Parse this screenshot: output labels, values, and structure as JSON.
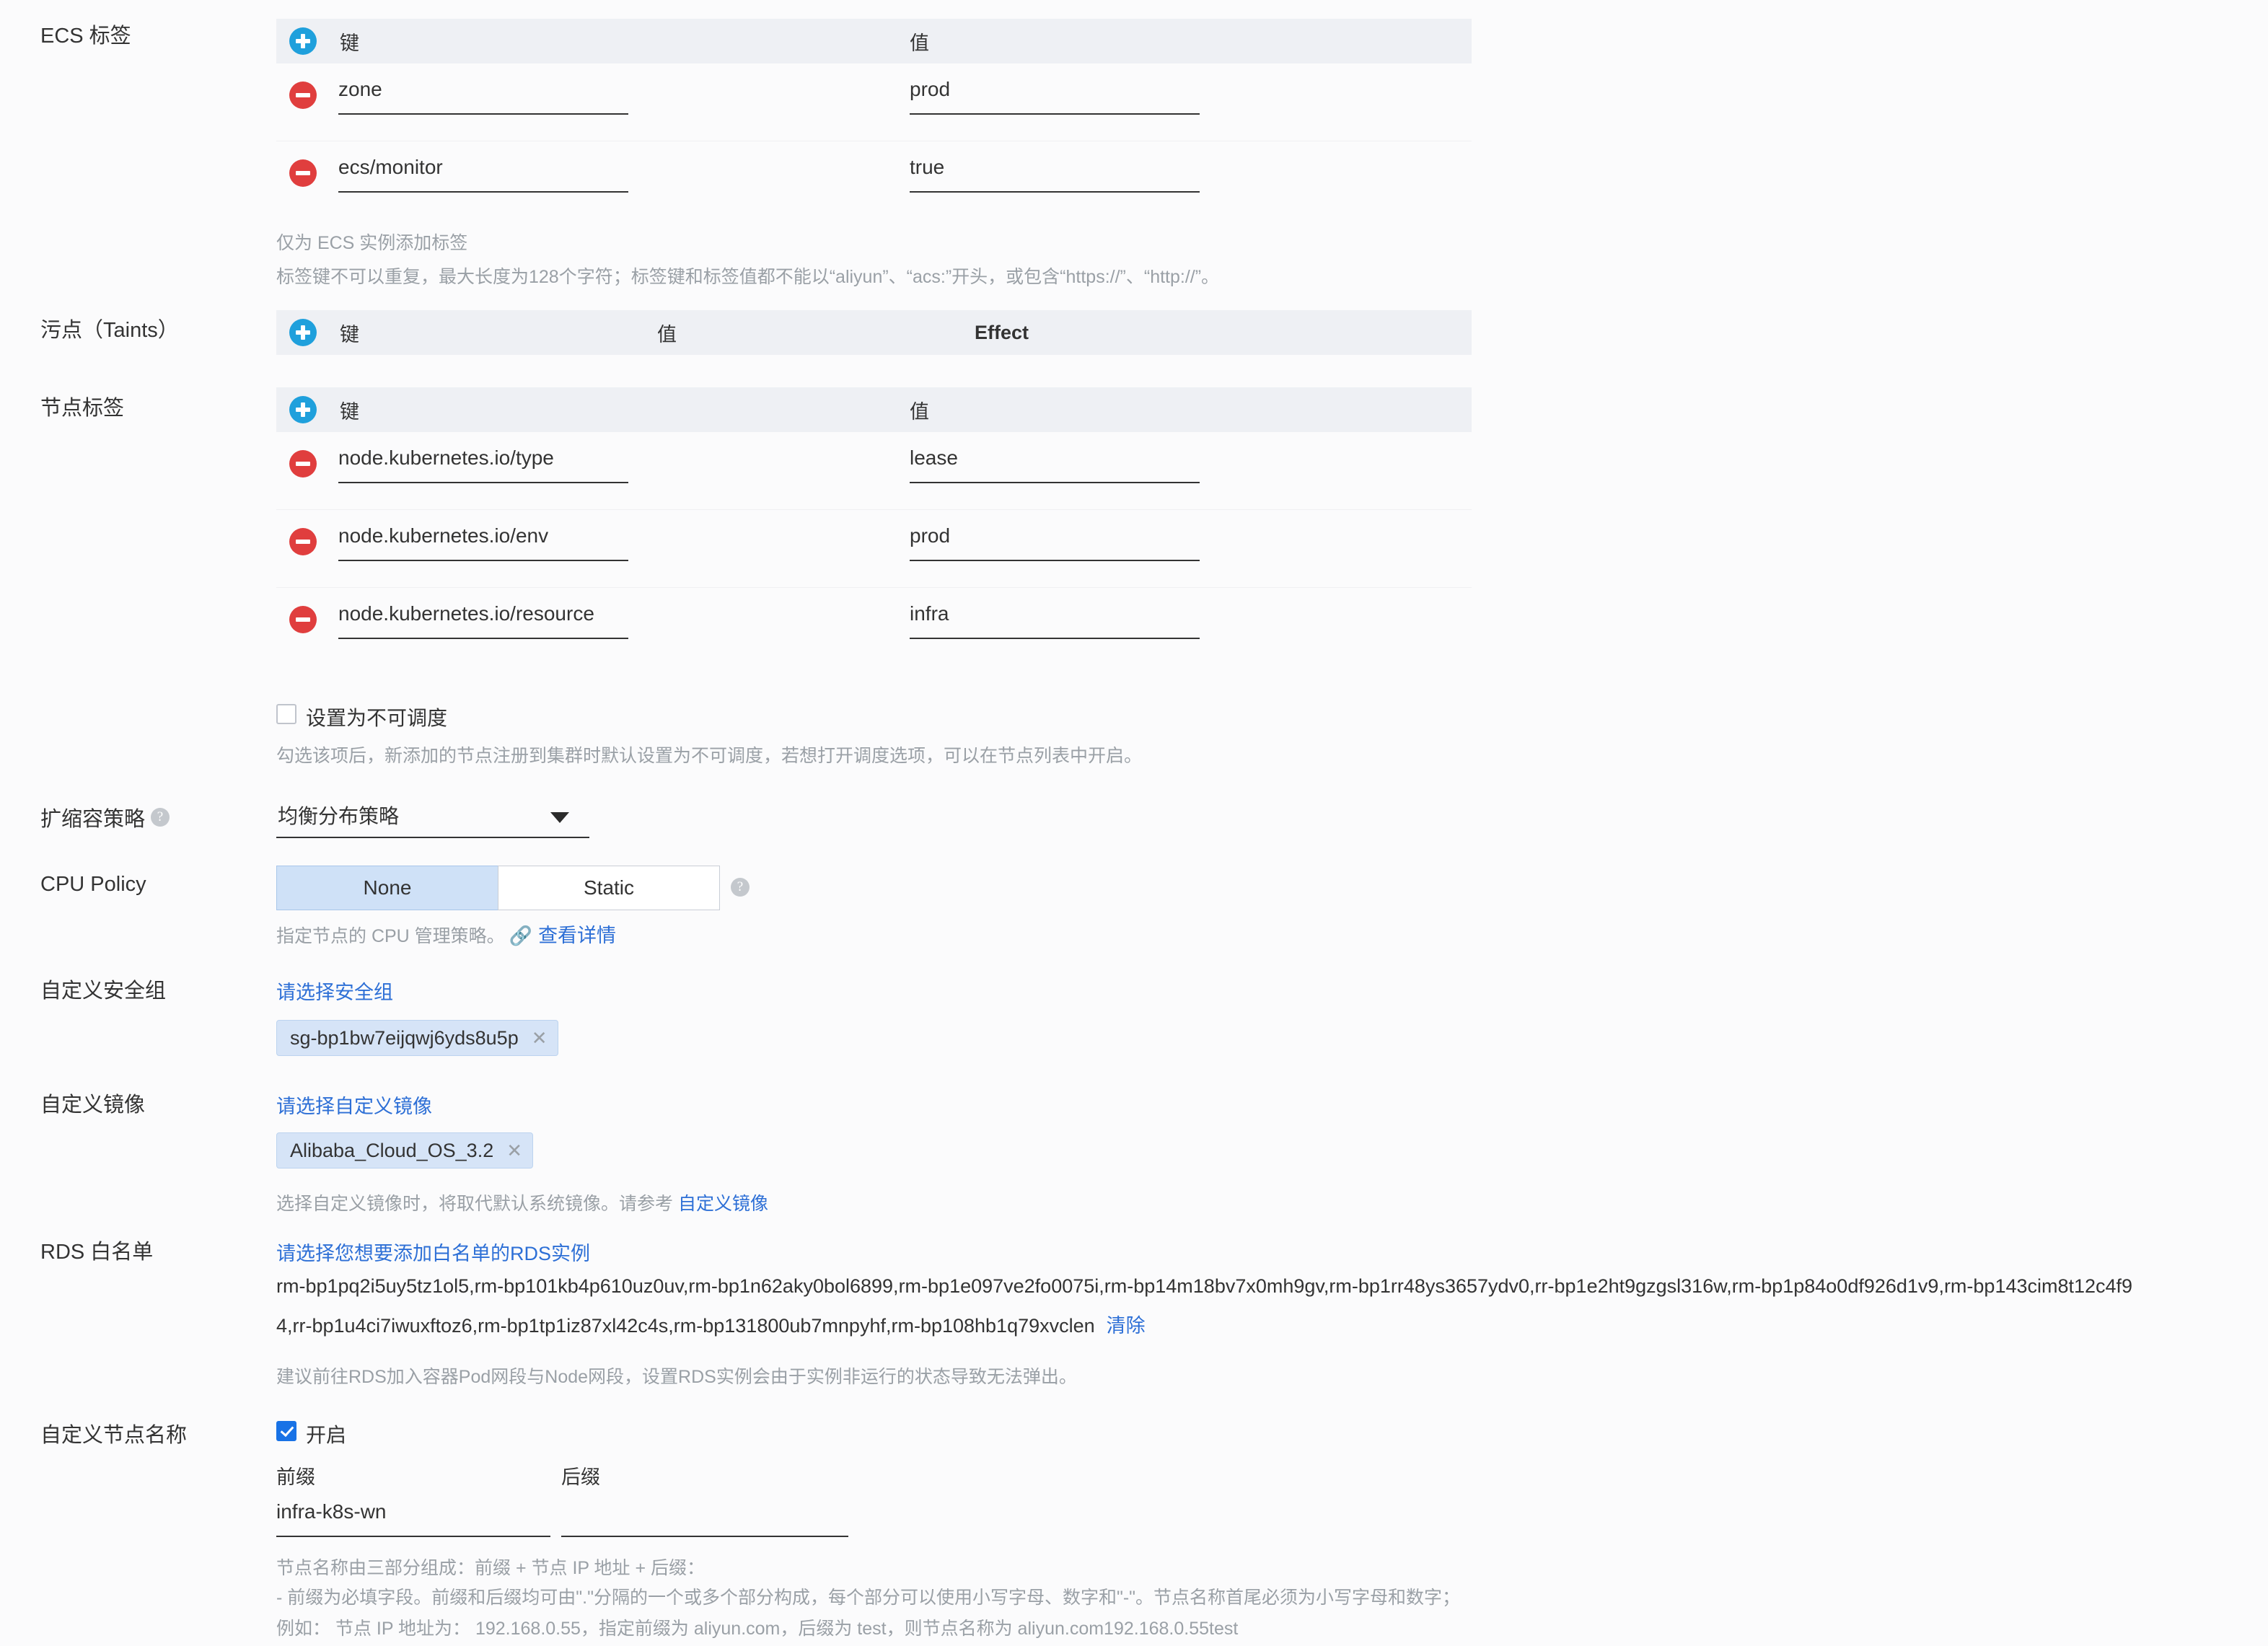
{
  "ecs_tags": {
    "label": "ECS 标签",
    "columns": {
      "key": "键",
      "value": "值"
    },
    "rows": [
      {
        "key": "zone",
        "value": "prod"
      },
      {
        "key": "ecs/monitor",
        "value": "true"
      }
    ],
    "hints": [
      "仅为 ECS 实例添加标签",
      "标签键不可以重复，最大长度为128个字符；标签键和标签值都不能以“aliyun”、“acs:”开头，或包含“https://”、“http://”。"
    ]
  },
  "taints": {
    "label": "污点（Taints）",
    "columns": {
      "key": "键",
      "value": "值",
      "effect": "Effect"
    },
    "rows": []
  },
  "node_labels": {
    "label": "节点标签",
    "columns": {
      "key": "键",
      "value": "值"
    },
    "rows": [
      {
        "key": "node.kubernetes.io/type",
        "value": "lease"
      },
      {
        "key": "node.kubernetes.io/env",
        "value": "prod"
      },
      {
        "key": "node.kubernetes.io/resource",
        "value": "infra"
      }
    ]
  },
  "unschedulable": {
    "checkbox_label": "设置为不可调度",
    "checked": false,
    "hint": "勾选该项后，新添加的节点注册到集群时默认设置为不可调度，若想打开调度选项，可以在节点列表中开启。"
  },
  "scaling_policy": {
    "label": "扩缩容策略",
    "selected": "均衡分布策略"
  },
  "cpu_policy": {
    "label": "CPU Policy",
    "options": [
      "None",
      "Static"
    ],
    "selected": "None",
    "hint_prefix": "指定节点的 CPU 管理策略。",
    "hint_link": "查看详情"
  },
  "security_group": {
    "label": "自定义安全组",
    "link": "请选择安全组",
    "chips": [
      "sg-bp1bw7eijqwj6yds8u5p"
    ]
  },
  "custom_image": {
    "label": "自定义镜像",
    "link": "请选择自定义镜像",
    "chips": [
      "Alibaba_Cloud_OS_3.2"
    ],
    "hint_prefix": "选择自定义镜像时，将取代默认系统镜像。请参考 ",
    "hint_link": "自定义镜像"
  },
  "rds_whitelist": {
    "label": "RDS 白名单",
    "link": "请选择您想要添加白名单的RDS实例",
    "value": "rm-bp1pq2i5uy5tz1ol5,rm-bp101kb4p610uz0uv,rm-bp1n62aky0bol6899,rm-bp1e097ve2fo0075i,rm-bp14m18bv7x0mh9gv,rm-bp1rr48ys3657ydv0,rr-bp1e2ht9gzgsl316w,rm-bp1p84o0df926d1v9,rm-bp143cim8t12c4f94,rr-bp1u4ci7iwuxftoz6,rm-bp1tp1iz87xl42c4s,rm-bp131800ub7mnpyhf,rm-bp108hb1q79xvclen",
    "clear_label": "清除",
    "hint": "建议前往RDS加入容器Pod网段与Node网段，设置RDS实例会由于实例非运行的状态导致无法弹出。"
  },
  "custom_node_name": {
    "label": "自定义节点名称",
    "checkbox_label": "开启",
    "checked": true,
    "prefix_label": "前缀",
    "prefix_value": "infra-k8s-wn",
    "suffix_label": "后缀",
    "suffix_value": "",
    "hints": [
      "节点名称由三部分组成：前缀 + 节点 IP 地址 + 后缀：",
      "- 前缀为必填字段。前缀和后缀均可由\".\"分隔的一个或多个部分构成，每个部分可以使用小写字母、数字和\"-\"。节点名称首尾必须为小写字母和数字；",
      "例如： 节点 IP 地址为： 192.168.0.55，指定前缀为 aliyun.com，后缀为 test，则节点名称为 aliyun.com192.168.0.55test"
    ]
  },
  "colors": {
    "accent_blue": "#1fa0dc",
    "delete_red": "#e03e3e",
    "link_blue": "#2d6fd6",
    "header_bg": "#eef0f4",
    "checkbox_checked": "#1872e6"
  }
}
